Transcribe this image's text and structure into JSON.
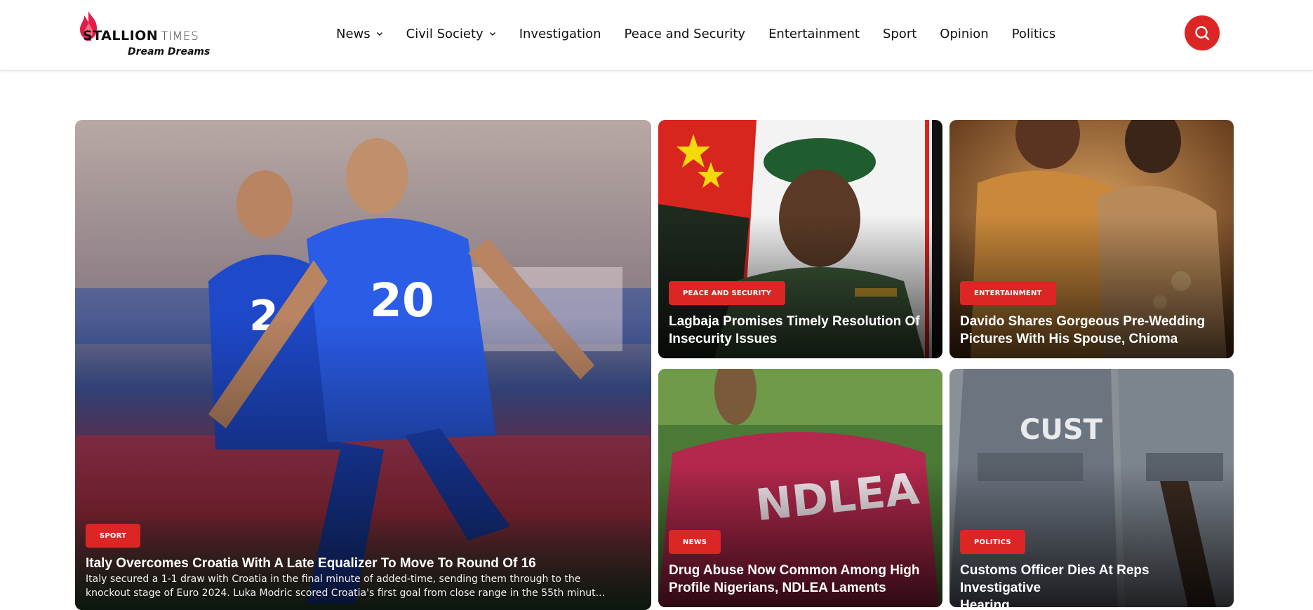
{
  "brand": {
    "name_bold": "STALLION",
    "name_light": "TIMES",
    "tagline": "Dream Dreams",
    "accent_color": "#dc2626"
  },
  "nav": {
    "items": [
      {
        "label": "News",
        "has_dropdown": true
      },
      {
        "label": "Civil Society",
        "has_dropdown": true
      },
      {
        "label": "Investigation",
        "has_dropdown": false
      },
      {
        "label": "Peace and Security",
        "has_dropdown": false
      },
      {
        "label": "Entertainment",
        "has_dropdown": false
      },
      {
        "label": "Sport",
        "has_dropdown": false
      },
      {
        "label": "Opinion",
        "has_dropdown": false
      },
      {
        "label": "Politics",
        "has_dropdown": false
      }
    ],
    "search_icon": "search-icon"
  },
  "featured": {
    "category": "SPORT",
    "title": "Italy Overcomes Croatia With A Late Equalizer To Move To Round Of 16",
    "excerpt_line1": "Italy secured a 1-1 draw with Croatia in the final minute of added-time, sending them through to the",
    "excerpt_line2": "knockout stage of Euro 2024. Luka Modric scored Croatia's first goal from close range in the 55th minut..."
  },
  "cards": [
    {
      "category": "PEACE AND SECURITY",
      "title_line1": "Lagbaja Promises Timely Resolution Of",
      "title_line2": "Insecurity Issues"
    },
    {
      "category": "ENTERTAINMENT",
      "title_line1": "Davido Shares Gorgeous Pre-Wedding",
      "title_line2": "Pictures With His Spouse, Chioma"
    },
    {
      "category": "NEWS",
      "title_line1": "Drug Abuse Now Common Among High",
      "title_line2": "Profile Nigerians, NDLEA Laments"
    },
    {
      "category": "POLITICS",
      "title_line1": "Customs Officer Dies At Reps Investigative",
      "title_line2": "Hearing"
    }
  ]
}
